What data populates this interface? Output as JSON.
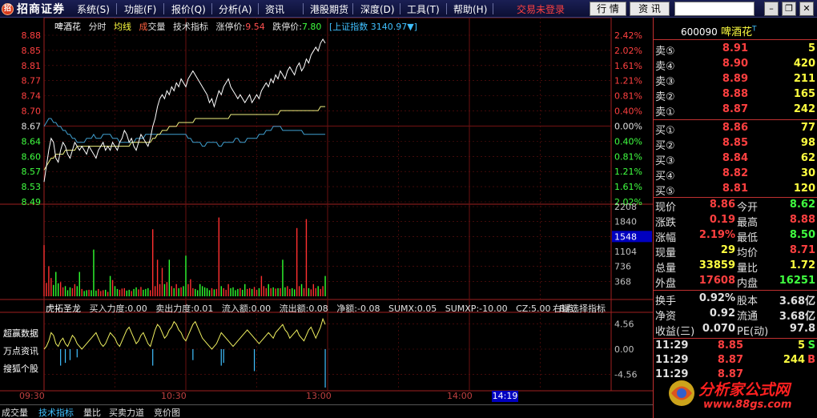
{
  "app": {
    "logo_mark": "招",
    "name": "招商证券",
    "menu": [
      {
        "label": "系统(S)"
      },
      {
        "label": "功能(F)"
      },
      {
        "label": "报价(Q)"
      },
      {
        "label": "分析(A)"
      },
      {
        "label": "资讯"
      },
      {
        "label": "港股期货"
      },
      {
        "label": "深度(D)"
      },
      {
        "label": "工具(T)"
      },
      {
        "label": "帮助(H)"
      }
    ],
    "login_status": "交易未登录",
    "btn_quote": "行 情",
    "btn_info": "资 讯",
    "win_min": "–",
    "win_restore": "❐",
    "win_close": "✕"
  },
  "chart_header": {
    "name": "啤酒花",
    "mode": "分时",
    "avg": "均线",
    "vol_a": "成",
    "vol_b": "交量",
    "tech": "技术指标",
    "limit_up_label": "涨停价:",
    "limit_up": "9.54",
    "limit_down_label": "跌停价:",
    "limit_down": "7.80",
    "index": "[上证指数 3140.97▼]"
  },
  "indicator_header": {
    "name": "虎拓圣龙",
    "buy_power": "买入力度:0.00",
    "sell_power": "卖出力度:0.01",
    "inflow": "流入额:0.00",
    "outflow": "流出额:0.08",
    "net": "净额:-0.08",
    "sumx": "SUMX:0.05",
    "sumxp": "SUMXP:-10.00",
    "cz": "CZ:5.00",
    "b": "B点:",
    "overlay": "右键选择指标"
  },
  "side_labels": [
    "超赢数据",
    "万点资讯",
    "搜狐个股"
  ],
  "time_axis": {
    "labels": [
      "09:30",
      "10:30",
      "13:00",
      "14:00"
    ],
    "cursor": "14:19"
  },
  "tabs": [
    {
      "label": "成交量",
      "active": false
    },
    {
      "label": "技术指标",
      "active": true
    },
    {
      "label": "量比",
      "active": false
    },
    {
      "label": "买卖力道",
      "active": false
    },
    {
      "label": "竞价图",
      "active": false
    }
  ],
  "panel": {
    "code": "600090",
    "name": "啤酒花",
    "suffix": "T",
    "asks": [
      {
        "label": "卖⑤",
        "price": "8.91",
        "vol": "5"
      },
      {
        "label": "卖④",
        "price": "8.90",
        "vol": "420"
      },
      {
        "label": "卖③",
        "price": "8.89",
        "vol": "211"
      },
      {
        "label": "卖②",
        "price": "8.88",
        "vol": "165"
      },
      {
        "label": "卖①",
        "price": "8.87",
        "vol": "242"
      }
    ],
    "bids": [
      {
        "label": "买①",
        "price": "8.86",
        "vol": "77"
      },
      {
        "label": "买②",
        "price": "8.85",
        "vol": "98"
      },
      {
        "label": "买③",
        "price": "8.84",
        "vol": "62"
      },
      {
        "label": "买④",
        "price": "8.82",
        "vol": "30"
      },
      {
        "label": "买⑤",
        "price": "8.81",
        "vol": "120"
      }
    ],
    "stats": [
      {
        "l1": "现价",
        "v1": "8.86",
        "c1": "red",
        "l2": "今开",
        "v2": "8.62",
        "c2": "green"
      },
      {
        "l1": "涨跌",
        "v1": "0.19",
        "c1": "red",
        "l2": "最高",
        "v2": "8.88",
        "c2": "red"
      },
      {
        "l1": "涨幅",
        "v1": "2.19%",
        "c1": "red",
        "l2": "最低",
        "v2": "8.50",
        "c2": "green"
      },
      {
        "l1": "现量",
        "v1": "29",
        "c1": "yellow",
        "l2": "均价",
        "v2": "8.71",
        "c2": "red"
      },
      {
        "l1": "总量",
        "v1": "33859",
        "c1": "yellow",
        "l2": "量比",
        "v2": "1.72",
        "c2": "yellow"
      },
      {
        "l1": "外盘",
        "v1": "17608",
        "c1": "red",
        "l2": "内盘",
        "v2": "16251",
        "c2": "green"
      }
    ],
    "stats2": [
      {
        "l1": "换手",
        "v1": "0.92%",
        "c1": "white",
        "l2": "股本",
        "v2": "3.68亿",
        "c2": "white"
      },
      {
        "l1": "净资",
        "v1": "0.92",
        "c1": "white",
        "l2": "流通",
        "v2": "3.68亿",
        "c2": "white"
      },
      {
        "l1": "收益(三)",
        "v1": "0.070",
        "c1": "white",
        "l2": "PE(动)",
        "v2": "97.8",
        "c2": "white"
      }
    ],
    "ticks": [
      {
        "time": "11:29",
        "price": "8.85",
        "vol": "5",
        "side": "S",
        "color": "#40ff40"
      },
      {
        "time": "11:29",
        "price": "8.87",
        "vol": "244",
        "side": "B",
        "color": "#ff4040"
      },
      {
        "time": "11:29",
        "price": "8.87",
        "vol": "",
        "side": "",
        "color": "#ff4040"
      }
    ]
  },
  "watermark": {
    "text": "分析家公式网",
    "url": "www.88gs.com"
  },
  "chart_data": {
    "type": "line",
    "y_left_ticks": [
      "8.88",
      "8.85",
      "8.81",
      "8.77",
      "8.74",
      "8.70",
      "8.67",
      "8.64",
      "8.60",
      "8.57",
      "8.53",
      "8.49"
    ],
    "y_right_ticks": [
      "2.42%",
      "2.02%",
      "1.61%",
      "1.21%",
      "0.81%",
      "0.40%",
      "0.00%",
      "0.40%",
      "0.81%",
      "1.21%",
      "1.61%",
      "2.02%"
    ],
    "prev_close": 8.67,
    "ylim": [
      8.47,
      8.89
    ],
    "session_minutes": 240,
    "price_series": [
      8.52,
      8.56,
      8.6,
      8.63,
      8.62,
      8.58,
      8.57,
      8.6,
      8.62,
      8.61,
      8.59,
      8.58,
      8.6,
      8.62,
      8.61,
      8.6,
      8.61,
      8.6,
      8.59,
      8.61,
      8.6,
      8.59,
      8.58,
      8.6,
      8.61,
      8.62,
      8.6,
      8.61,
      8.6,
      8.62,
      8.61,
      8.6,
      8.62,
      8.63,
      8.65,
      8.64,
      8.62,
      8.63,
      8.61,
      8.6,
      8.62,
      8.64,
      8.63,
      8.62,
      8.61,
      8.63,
      8.66,
      8.68,
      8.71,
      8.73,
      8.74,
      8.73,
      8.75,
      8.74,
      8.76,
      8.75,
      8.77,
      8.76,
      8.78,
      8.77,
      8.76,
      8.78,
      8.79,
      8.8,
      8.79,
      8.78,
      8.77,
      8.76,
      8.75,
      8.74,
      8.72,
      8.73,
      8.71,
      8.73,
      8.75,
      8.74,
      8.76,
      8.77,
      8.78,
      8.76,
      8.75,
      8.74,
      8.73,
      8.74,
      8.73,
      8.72,
      8.73,
      8.74,
      8.72,
      8.73,
      8.74,
      8.73,
      8.75,
      8.76,
      8.77,
      8.76,
      8.78,
      8.77,
      8.79,
      8.78,
      8.8,
      8.79,
      8.78,
      8.8,
      8.81,
      8.8,
      8.79,
      8.81,
      8.82,
      8.8,
      8.81,
      8.83,
      8.82,
      8.84,
      8.85,
      8.86,
      8.85,
      8.87,
      8.88,
      8.87
    ],
    "avg_series": [
      8.55,
      8.56,
      8.57,
      8.58,
      8.58,
      8.59,
      8.59,
      8.59,
      8.59,
      8.6,
      8.6,
      8.6,
      8.6,
      8.6,
      8.61,
      8.61,
      8.61,
      8.61,
      8.61,
      8.61,
      8.61,
      8.61,
      8.61,
      8.61,
      8.61,
      8.61,
      8.61,
      8.61,
      8.61,
      8.61,
      8.61,
      8.61,
      8.61,
      8.61,
      8.61,
      8.61,
      8.61,
      8.62,
      8.62,
      8.62,
      8.62,
      8.62,
      8.62,
      8.62,
      8.62,
      8.62,
      8.63,
      8.63,
      8.64,
      8.64,
      8.65,
      8.65,
      8.65,
      8.66,
      8.66,
      8.66,
      8.66,
      8.67,
      8.67,
      8.67,
      8.67,
      8.67,
      8.67,
      8.67,
      8.68,
      8.68,
      8.68,
      8.68,
      8.68,
      8.68,
      8.68,
      8.68,
      8.68,
      8.68,
      8.68,
      8.68,
      8.68,
      8.68,
      8.68,
      8.69,
      8.69,
      8.69,
      8.69,
      8.69,
      8.69,
      8.69,
      8.69,
      8.69,
      8.69,
      8.69,
      8.69,
      8.69,
      8.69,
      8.69,
      8.69,
      8.69,
      8.69,
      8.69,
      8.69,
      8.69,
      8.7,
      8.7,
      8.7,
      8.7,
      8.7,
      8.7,
      8.7,
      8.7,
      8.7,
      8.7,
      8.7,
      8.7,
      8.7,
      8.7,
      8.7,
      8.7,
      8.7,
      8.71,
      8.71,
      8.71
    ],
    "index_series": [
      8.66,
      8.67,
      8.68,
      8.68,
      8.67,
      8.67,
      8.66,
      8.66,
      8.65,
      8.65,
      8.64,
      8.64,
      8.63,
      8.63,
      8.62,
      8.62,
      8.62,
      8.62,
      8.63,
      8.63,
      8.63,
      8.64,
      8.63,
      8.63,
      8.63,
      8.64,
      8.64,
      8.64,
      8.64,
      8.63,
      8.63,
      8.63,
      8.62,
      8.62,
      8.62,
      8.62,
      8.62,
      8.62,
      8.62,
      8.63,
      8.63,
      8.63,
      8.63,
      8.64,
      8.64,
      8.64,
      8.64,
      8.64,
      8.64,
      8.64,
      8.64,
      8.64,
      8.64,
      8.64,
      8.64,
      8.64,
      8.64,
      8.64,
      8.64,
      8.64,
      8.64,
      8.63,
      8.63,
      8.62,
      8.62,
      8.62,
      8.62,
      8.61,
      8.61,
      8.62,
      8.62,
      8.62,
      8.62,
      8.62,
      8.61,
      8.61,
      8.62,
      8.62,
      8.62,
      8.62,
      8.62,
      8.63,
      8.63,
      8.62,
      8.62,
      8.62,
      8.63,
      8.63,
      8.63,
      8.63,
      8.63,
      8.64,
      8.64,
      8.64,
      8.65,
      8.65,
      8.65,
      8.66,
      8.66,
      8.66,
      8.66,
      8.65,
      8.65,
      8.65,
      8.65,
      8.65,
      8.65,
      8.65,
      8.65,
      8.65,
      8.64,
      8.64,
      8.64,
      8.64,
      8.64,
      8.64,
      8.64,
      8.64,
      8.64,
      8.64
    ],
    "volume_ticks": [
      "2208",
      "1840",
      "1548",
      "1104",
      "736",
      "368"
    ],
    "volume_max": 2208,
    "volume_highlight": "1548",
    "volumes": [
      1260,
      330,
      740,
      450,
      280,
      600,
      320,
      350,
      220,
      250,
      150,
      220,
      200,
      300,
      250,
      600,
      180,
      130,
      150,
      160,
      150,
      1150,
      140,
      180,
      130,
      150,
      160,
      110,
      500,
      400,
      250,
      180,
      160,
      190,
      200,
      140,
      160,
      130,
      180,
      220,
      170,
      230,
      160,
      180,
      200,
      150,
      1650,
      250,
      900,
      300,
      700,
      300,
      350,
      900,
      250,
      200,
      300,
      200,
      220,
      250,
      1000,
      300,
      420,
      200,
      180,
      150,
      300,
      250,
      220,
      200,
      150,
      200,
      170,
      180,
      1940,
      250,
      200,
      160,
      300,
      200,
      220,
      150,
      180,
      200,
      160,
      300,
      180,
      200,
      180,
      230,
      160,
      200,
      500,
      250,
      200,
      300,
      200,
      220,
      190,
      200,
      200,
      900,
      220,
      250,
      180,
      200,
      170,
      1680,
      250,
      300,
      200,
      1900,
      200,
      170,
      300,
      200,
      250,
      180,
      250,
      500
    ],
    "indicator_ticks": [
      "4.56",
      "0.00",
      "-4.56"
    ],
    "indicator_ylim": [
      -7,
      7
    ],
    "indicator_line": [
      0,
      0.5,
      1.5,
      3,
      2.5,
      1,
      0.5,
      1.5,
      2,
      1,
      0.5,
      1.5,
      2.5,
      2,
      1,
      0.5,
      0,
      0.5,
      1,
      1.5,
      2,
      2.5,
      3,
      2,
      1,
      0.5,
      1,
      2,
      3,
      2.5,
      2,
      1,
      0.5,
      1.5,
      2.5,
      3.5,
      4,
      3,
      2,
      1,
      1.5,
      2.5,
      3,
      2,
      1,
      0.5,
      2,
      3.5,
      4.5,
      4,
      3,
      2,
      2.5,
      3.5,
      4,
      5,
      4.5,
      3.5,
      3,
      2,
      1.5,
      2.5,
      3.5,
      4.5,
      5,
      4,
      3,
      2,
      1.5,
      1,
      0.5,
      0,
      0.5,
      1,
      2,
      3,
      2.5,
      2,
      1.5,
      1,
      0.5,
      1,
      1.5,
      2,
      2.5,
      3,
      3.5,
      3,
      2.5,
      2,
      1.5,
      1,
      1.5,
      2,
      2.5,
      3,
      2.5,
      2,
      3,
      3.5,
      4,
      4.5,
      3.5,
      3,
      2,
      2.5,
      3,
      3.5,
      2.5,
      2,
      1.5,
      2.5,
      3.5,
      4,
      3,
      2,
      3,
      4,
      5.5,
      4.5
    ],
    "indicator_bars": [
      0,
      0,
      0,
      0,
      0,
      0,
      0,
      -3,
      0,
      -2.5,
      0,
      -2,
      0,
      0,
      -1.5,
      0,
      0,
      0,
      0,
      0,
      0,
      0,
      0,
      0,
      0,
      0,
      0,
      0,
      0,
      0,
      0,
      0,
      0,
      0,
      0,
      0,
      0,
      0,
      0,
      0,
      0,
      0,
      0,
      0,
      0,
      0,
      -3,
      0,
      0,
      0,
      0,
      0,
      0,
      0,
      0,
      0,
      0,
      0,
      0,
      0,
      0,
      0,
      0,
      -2,
      0,
      0,
      0,
      0,
      0,
      0,
      0,
      0,
      0,
      0,
      0,
      -3,
      -2.5,
      0,
      0,
      0,
      0,
      0,
      0,
      0,
      0,
      0,
      0,
      0,
      0,
      -4,
      0,
      0,
      0,
      0,
      0,
      0,
      0,
      0,
      0,
      0,
      0,
      0,
      0,
      0,
      0,
      0,
      0,
      0,
      0,
      0,
      0,
      0,
      0,
      0,
      0,
      0,
      0,
      0,
      0,
      -7
    ],
    "grid": true
  }
}
